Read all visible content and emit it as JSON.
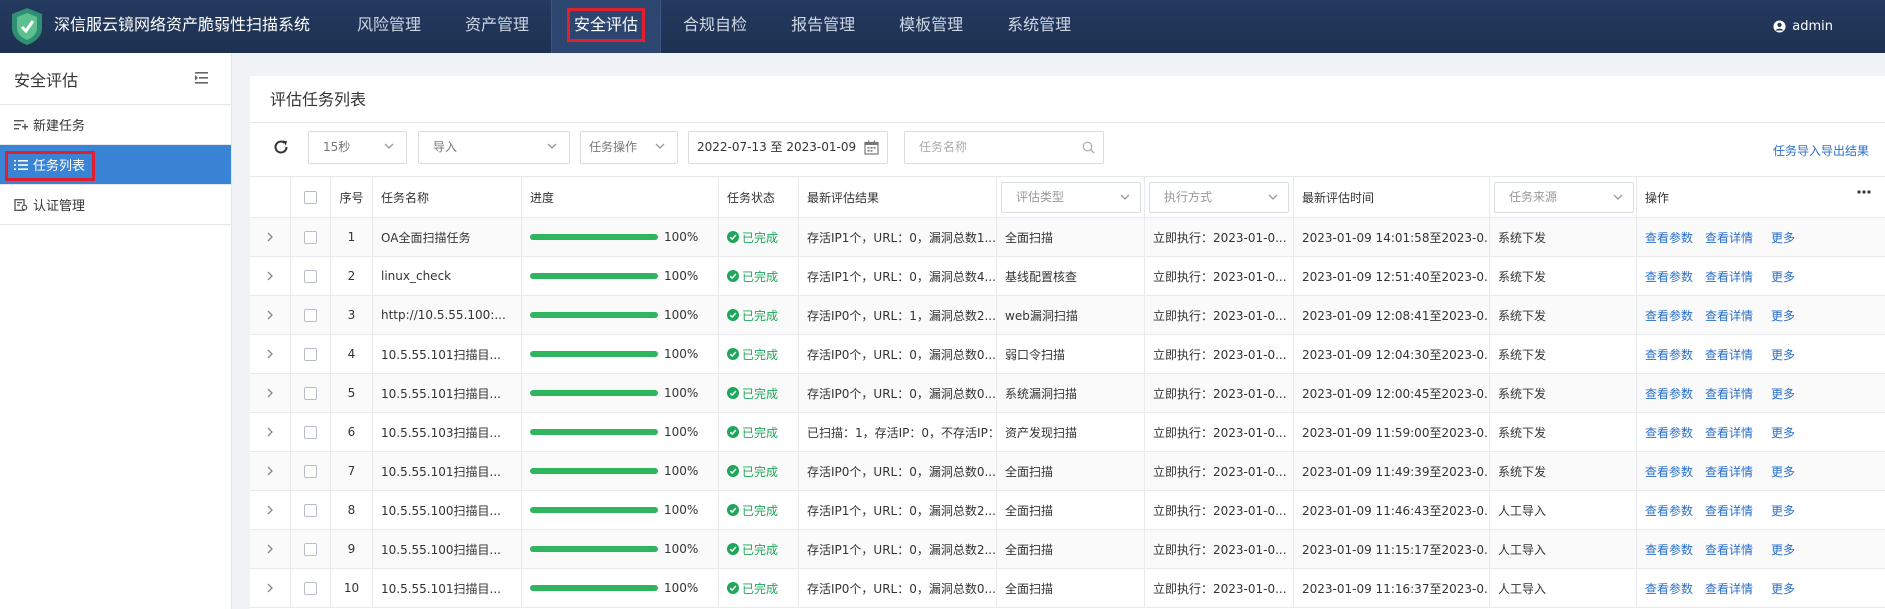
{
  "app": {
    "title": "深信服云镜网络资产脆弱性扫描系统",
    "user": "admin"
  },
  "nav": [
    {
      "label": "风险管理"
    },
    {
      "label": "资产管理"
    },
    {
      "label": "安全评估",
      "active": true
    },
    {
      "label": "合规自检"
    },
    {
      "label": "报告管理"
    },
    {
      "label": "模板管理"
    },
    {
      "label": "系统管理"
    }
  ],
  "sidebar": {
    "title": "安全评估",
    "items": [
      {
        "label": "新建任务"
      },
      {
        "label": "任务列表",
        "active": true
      },
      {
        "label": "认证管理"
      }
    ]
  },
  "page": {
    "title": "评估任务列表"
  },
  "toolbar": {
    "interval": "15秒",
    "import": "导入",
    "task_ops": "任务操作",
    "date_range": "2022-07-13 至 2023-01-09",
    "search_placeholder": "任务名称",
    "export_link": "任务导入导出结果"
  },
  "table": {
    "headers": {
      "index": "序号",
      "name": "任务名称",
      "progress": "进度",
      "status": "任务状态",
      "result": "最新评估结果",
      "type": "评估类型",
      "exec": "执行方式",
      "time": "最新评估时间",
      "source": "任务来源",
      "ops": "操作"
    },
    "op_labels": [
      "查看参数",
      "查看详情",
      "更多"
    ],
    "rows": [
      {
        "index": "1",
        "name": "OA全面扫描任务",
        "progress": 100,
        "progress_text": "100%",
        "status": "已完成",
        "result": "存活IP1个，URL：0，漏洞总数1...",
        "type": "全面扫描",
        "exec": "立即执行：2023-01-0...",
        "time": "2023-01-09 14:01:58至2023-0...",
        "source": "系统下发"
      },
      {
        "index": "2",
        "name": "linux_check",
        "progress": 100,
        "progress_text": "100%",
        "status": "已完成",
        "result": "存活IP1个，URL：0，漏洞总数4...",
        "type": "基线配置核查",
        "exec": "立即执行：2023-01-0...",
        "time": "2023-01-09 12:51:40至2023-0...",
        "source": "系统下发"
      },
      {
        "index": "3",
        "name": "http://10.5.55.100:...",
        "progress": 100,
        "progress_text": "100%",
        "status": "已完成",
        "result": "存活IP0个，URL：1，漏洞总数2...",
        "type": "web漏洞扫描",
        "exec": "立即执行：2023-01-0...",
        "time": "2023-01-09 12:08:41至2023-0...",
        "source": "系统下发"
      },
      {
        "index": "4",
        "name": "10.5.55.101扫描目...",
        "progress": 100,
        "progress_text": "100%",
        "status": "已完成",
        "result": "存活IP0个，URL：0，漏洞总数0...",
        "type": "弱口令扫描",
        "exec": "立即执行：2023-01-0...",
        "time": "2023-01-09 12:04:30至2023-0...",
        "source": "系统下发"
      },
      {
        "index": "5",
        "name": "10.5.55.101扫描目...",
        "progress": 100,
        "progress_text": "100%",
        "status": "已完成",
        "result": "存活IP0个，URL：0，漏洞总数0...",
        "type": "系统漏洞扫描",
        "exec": "立即执行：2023-01-0...",
        "time": "2023-01-09 12:00:45至2023-0...",
        "source": "系统下发"
      },
      {
        "index": "6",
        "name": "10.5.55.103扫描目...",
        "progress": 100,
        "progress_text": "100%",
        "status": "已完成",
        "result": "已扫描：1，存活IP：0，不存活IP：...",
        "type": "资产发现扫描",
        "exec": "立即执行：2023-01-0...",
        "time": "2023-01-09 11:59:00至2023-0...",
        "source": "系统下发"
      },
      {
        "index": "7",
        "name": "10.5.55.101扫描目...",
        "progress": 100,
        "progress_text": "100%",
        "status": "已完成",
        "result": "存活IP0个，URL：0，漏洞总数0...",
        "type": "全面扫描",
        "exec": "立即执行：2023-01-0...",
        "time": "2023-01-09 11:49:39至2023-0...",
        "source": "系统下发"
      },
      {
        "index": "8",
        "name": "10.5.55.100扫描目...",
        "progress": 100,
        "progress_text": "100%",
        "status": "已完成",
        "result": "存活IP1个，URL：0，漏洞总数2...",
        "type": "全面扫描",
        "exec": "立即执行：2023-01-0...",
        "time": "2023-01-09 11:46:43至2023-0...",
        "source": "人工导入"
      },
      {
        "index": "9",
        "name": "10.5.55.100扫描目...",
        "progress": 100,
        "progress_text": "100%",
        "status": "已完成",
        "result": "存活IP1个，URL：0，漏洞总数2...",
        "type": "全面扫描",
        "exec": "立即执行：2023-01-0...",
        "time": "2023-01-09 11:15:17至2023-0...",
        "source": "人工导入"
      },
      {
        "index": "10",
        "name": "10.5.55.101扫描目...",
        "progress": 100,
        "progress_text": "100%",
        "status": "已完成",
        "result": "存活IP0个，URL：0，漏洞总数0...",
        "type": "全面扫描",
        "exec": "立即执行：2023-01-0...",
        "time": "2023-01-09 11:16:37至2023-0...",
        "source": "人工导入"
      }
    ]
  },
  "colors": {
    "nav_bg": "#1d3152",
    "accent": "#3a84d6",
    "success": "#2fb55e",
    "link": "#2a6fc9",
    "highlight": "#e0202f"
  }
}
